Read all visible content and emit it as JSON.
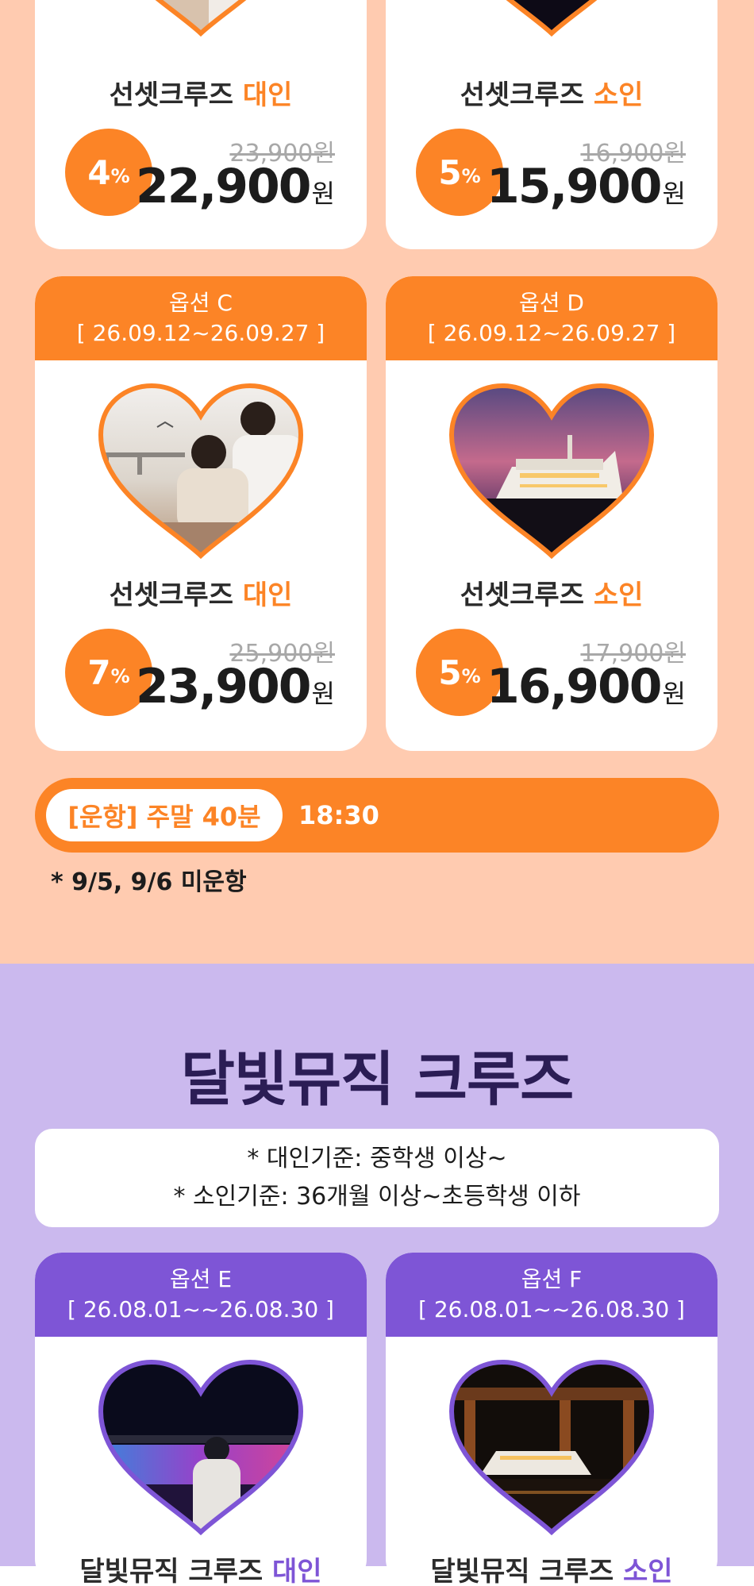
{
  "colors": {
    "orange": "#fc8426",
    "purple": "#7e55d6",
    "peach_bg": "#ffcbb0",
    "lavender_bg": "#cbb9ee"
  },
  "top_cards": [
    {
      "title_main": "선셋크루즈",
      "title_accent": "대인",
      "discount_num": "4",
      "discount_unit": "%",
      "original_price": "23,900원",
      "price": "22,900",
      "currency": "원"
    },
    {
      "title_main": "선셋크루즈",
      "title_accent": "소인",
      "discount_num": "5",
      "discount_unit": "%",
      "original_price": "16,900원",
      "price": "15,900",
      "currency": "원"
    }
  ],
  "middle_cards": [
    {
      "option": "옵션 C",
      "period": "[ 26.09.12~26.09.27 ]",
      "image_icon": "couple-photo-icon",
      "title_main": "선셋크루즈",
      "title_accent": "대인",
      "discount_num": "7",
      "discount_unit": "%",
      "original_price": "25,900원",
      "price": "23,900",
      "currency": "원"
    },
    {
      "option": "옵션 D",
      "period": "[ 26.09.12~26.09.27 ]",
      "image_icon": "cruise-ship-photo-icon",
      "title_main": "선셋크루즈",
      "title_accent": "소인",
      "discount_num": "5",
      "discount_unit": "%",
      "original_price": "17,900원",
      "price": "16,900",
      "currency": "원"
    }
  ],
  "schedule": {
    "label": "[운항] 주말 40분",
    "time": "18:30",
    "note": "* 9/5, 9/6 미운항"
  },
  "moonlight": {
    "title": "달빛뮤직 크루즈",
    "info_lines": [
      "* 대인기준: 중학생 이상~",
      "* 소인기준:  36개월 이상~초등학생 이하"
    ],
    "cards": [
      {
        "option": "옵션 E",
        "period": "[ 26.08.01~~26.08.30 ]",
        "image_icon": "fountain-night-photo-icon",
        "title_main": "달빛뮤직 크루즈",
        "title_accent": "대인"
      },
      {
        "option": "옵션 F",
        "period": "[ 26.08.01~~26.08.30 ]",
        "image_icon": "bridge-night-cruise-photo-icon",
        "title_main": "달빛뮤직 크루즈",
        "title_accent": "소인"
      }
    ]
  }
}
